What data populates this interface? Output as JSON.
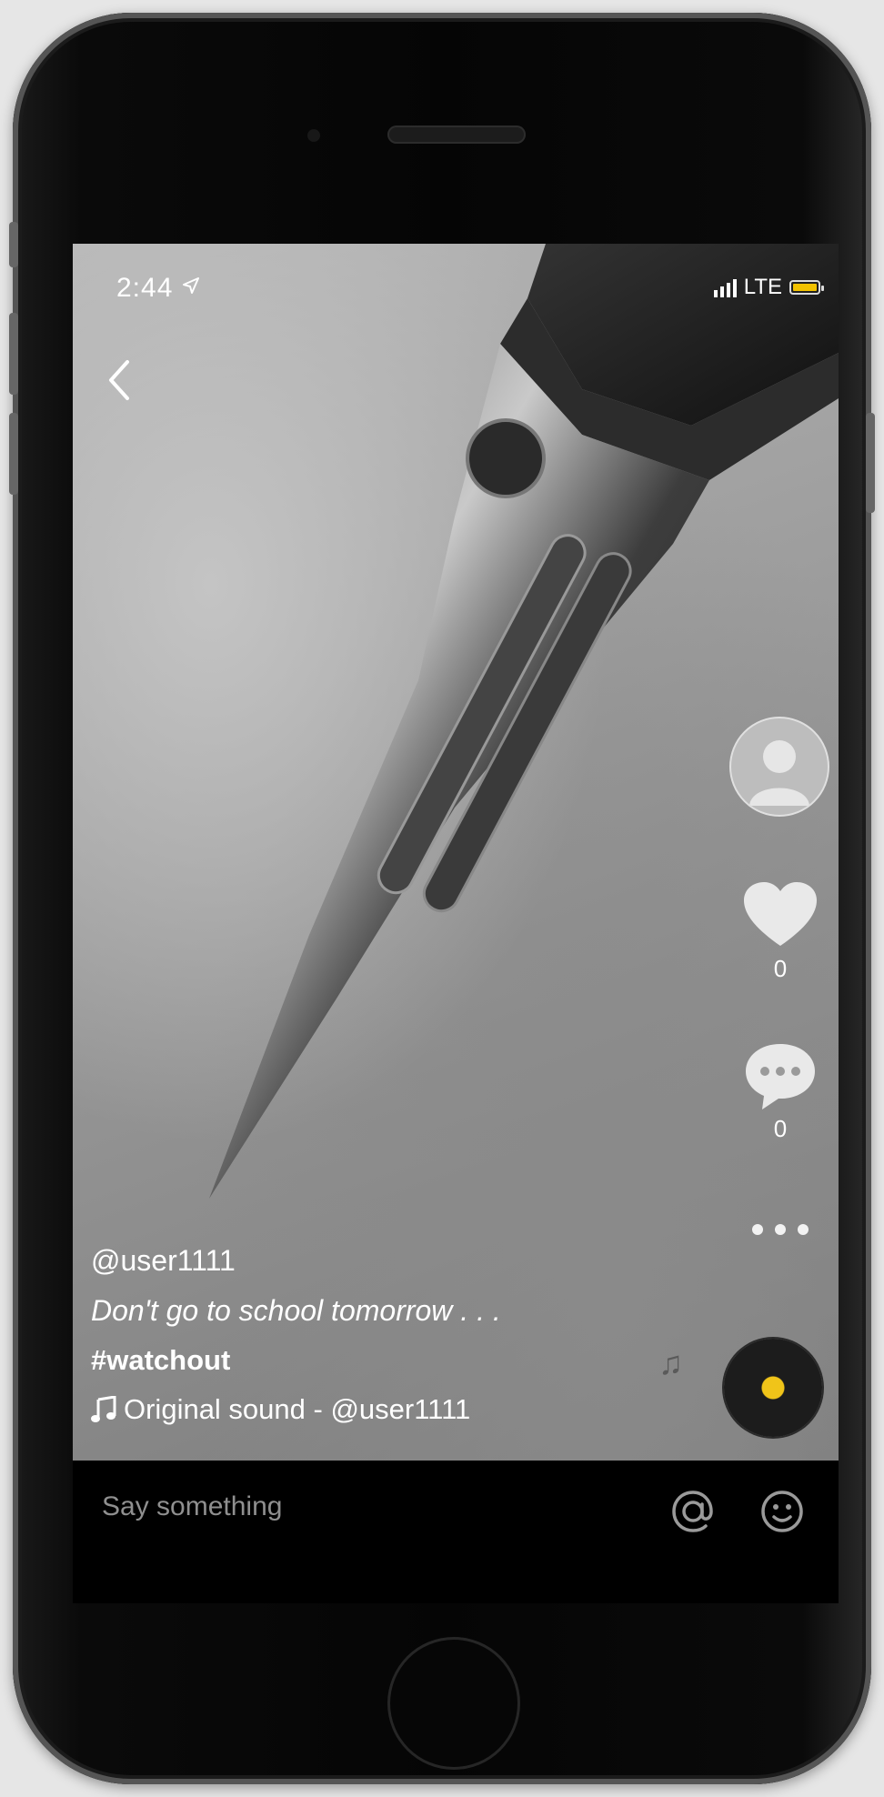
{
  "status_bar": {
    "time": "2:44",
    "network": "LTE",
    "battery_color": "#f2c200",
    "location_icon": "location-arrow-icon"
  },
  "video": {
    "author": "@user1111",
    "caption": "Don't go to school tomorrow . . .",
    "hashtag": "#watchout",
    "sound": "Original sound - @user1111"
  },
  "actions": {
    "likes": "0",
    "comments": "0"
  },
  "comment_bar": {
    "placeholder": "Say something"
  },
  "colors": {
    "accent": "#f0c419",
    "placeholder_text": "#8f8f8f"
  }
}
